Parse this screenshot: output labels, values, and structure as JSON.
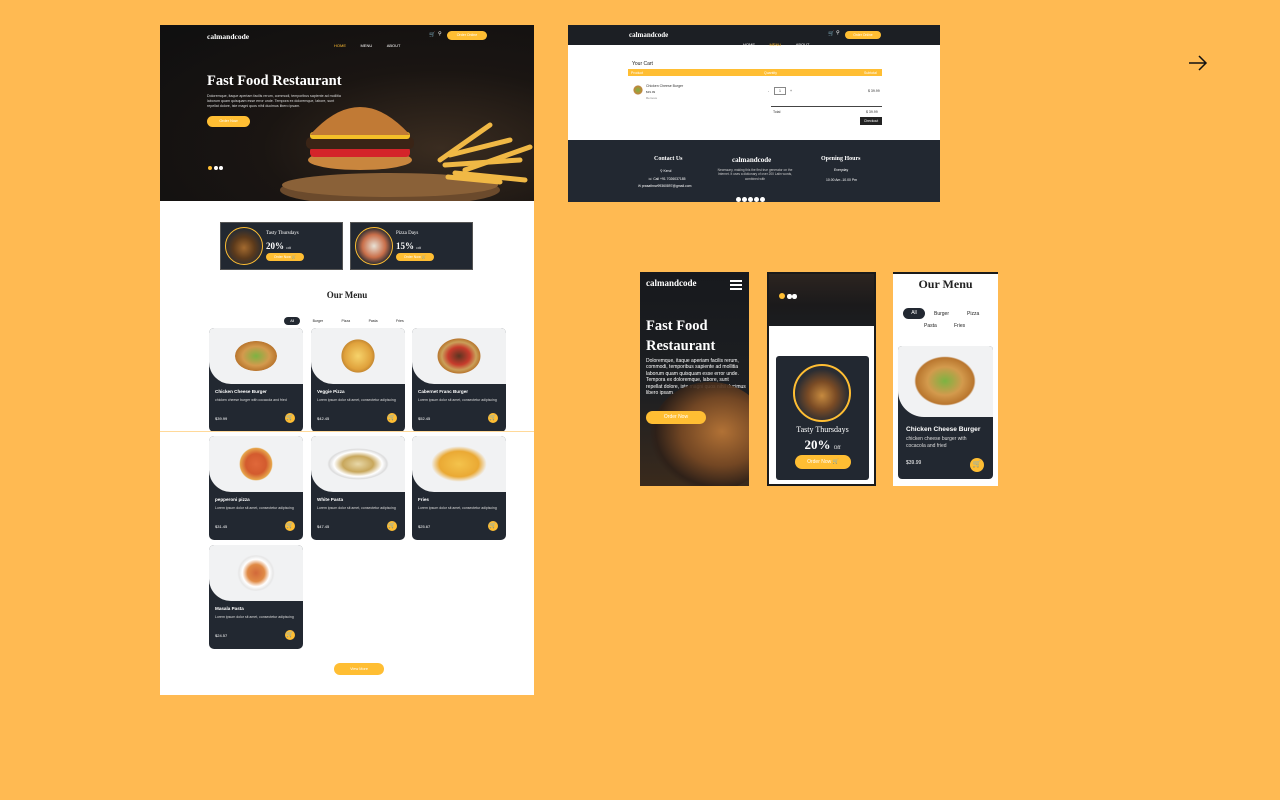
{
  "brand": "calmandcode",
  "nav": {
    "home": "HOME",
    "menu": "MENU",
    "about": "ABOUT",
    "order_online": "Order Online"
  },
  "hero": {
    "title": "Fast Food Restaurant",
    "text": "Doloremque, itaque aperiam facilis rerum, commodi, temporibus sapiente ad mollitia laborum quam quisquam esse error unde. Tempora ex doloremque, labore, sunt repellat dolore, iste magni quos nihil ducimus libero ipsam.",
    "cta": "Order Now"
  },
  "offers": [
    {
      "title": "Tasty Thursdays",
      "value": "20%",
      "suffix": "Off",
      "cta": "Order Now"
    },
    {
      "title": "Pizza Days",
      "value": "15%",
      "suffix": "Off",
      "cta": "Order Now"
    }
  ],
  "menu": {
    "title": "Our Menu",
    "filters": [
      "All",
      "Burger",
      "Pizza",
      "Pasta",
      "Fries"
    ],
    "items": [
      {
        "name": "Chicken Cheese Burger",
        "desc": "chicken cheese burger with cocacola and fried",
        "price": "$39.99"
      },
      {
        "name": "Veggie Pizza",
        "desc": "Lorem ipsum dolor sit amet, consectetur adipiscing",
        "price": "$42.45"
      },
      {
        "name": "Cabernet Franc Burger",
        "desc": "Lorem ipsum dolor sit amet, consectetur adipiscing",
        "price": "$52.45"
      },
      {
        "name": "pepperoni pizza",
        "desc": "Lorem ipsum dolor sit amet, consectetur adipiscing",
        "price": "$31.45"
      },
      {
        "name": "White Pasta",
        "desc": "Lorem ipsum dolor sit amet, consectetur adipiscing",
        "price": "$47.45"
      },
      {
        "name": "Fries",
        "desc": "Lorem ipsum dolor sit amet, consectetur adipiscing",
        "price": "$25.67"
      },
      {
        "name": "Masala Pasta",
        "desc": "Lorem ipsum dolor sit amet, consectetur adipiscing",
        "price": "$24.57"
      }
    ],
    "view_more": "View More"
  },
  "cart": {
    "title": "Your Cart",
    "col_product": "Product",
    "col_quantity": "Quantity",
    "col_subtotal": "Subtotal",
    "item_name": "Chicken Cheese Burger",
    "item_price": "$39.99",
    "item_remove": "Remove",
    "qty": "1",
    "minus": "-",
    "plus": "+",
    "line_total": "$ 39.99",
    "total_label": "Total",
    "total_value": "$ 39.99",
    "checkout": "Checkout"
  },
  "footer": {
    "contact_title": "Contact Us",
    "location": "Kerul",
    "phone": "Call +91 7026037185",
    "email": "prasathnw99360897@gmail.com",
    "brand_text": "Necessary, making this the first true generator on the Internet. It uses a dictionary of over 200 Latin words, combined with",
    "hours_title": "Opening Hours",
    "hours_days": "Everyday",
    "hours_time": "10.00 Am -10.00 Pm"
  },
  "mobile": {
    "m1_text": "Doloremque, itaque aperiam facilis rerum, commodi, temporibus sapiente ad mollitia laborum quam quisquam esse error unde. Tempora ex doloremque, labore, sunt repellat dolore, iste magni quos nihil ducimus libero ipsam.",
    "m3_filters": [
      "All",
      "Burger",
      "Pizza",
      "Pasta",
      "Fries"
    ]
  },
  "colors": {
    "accent": "#FFBE33",
    "dark": "#222831",
    "background": "#FFBA52"
  },
  "icons": [
    "cart-icon",
    "search-icon",
    "menu-icon",
    "arrow-right-icon",
    "location-icon",
    "phone-icon",
    "mail-icon"
  ]
}
